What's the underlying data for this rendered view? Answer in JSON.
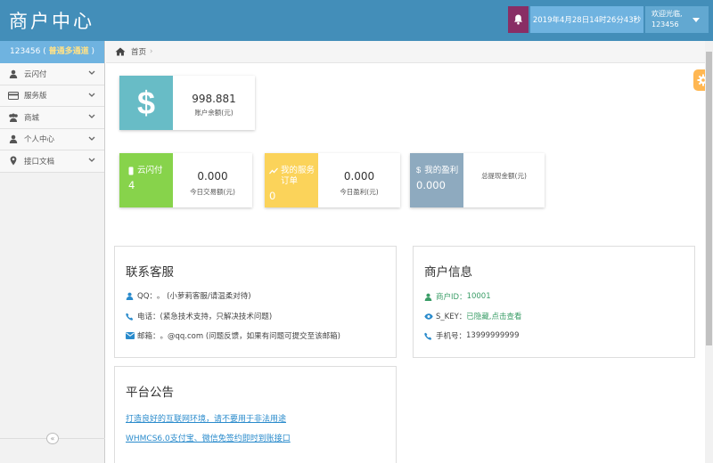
{
  "header": {
    "title": "商户中心",
    "datetime": "2019年4月28日14时26分43秒",
    "welcome": "欢迎光临,",
    "user": "123456"
  },
  "sidebar": {
    "account_id": "123456",
    "account_channel": "普通多通道",
    "items": [
      {
        "label": "云闪付",
        "icon": "user-icon"
      },
      {
        "label": "服务版",
        "icon": "credit-card-icon"
      },
      {
        "label": "商城",
        "icon": "users-icon"
      },
      {
        "label": "个人中心",
        "icon": "user-icon"
      },
      {
        "label": "接口文档",
        "icon": "map-marker-icon"
      }
    ],
    "collapse_glyph": "«"
  },
  "breadcrumb": {
    "home": "首页"
  },
  "stats": {
    "balance": {
      "value": "998.881",
      "label": "账户余额(元)",
      "symbol": "$"
    },
    "yunshanfu": {
      "title": "云闪付",
      "count": "4",
      "value": "0.000",
      "label": "今日交易额(元)"
    },
    "my_service": {
      "title": "我的服务订单",
      "count": "0",
      "value": "0.000",
      "label": "今日盈利(元)"
    },
    "my_profit": {
      "title": "我的盈利",
      "value": "0.000",
      "label": "总提现金额(元)"
    }
  },
  "contact": {
    "title": "联系客服",
    "qq_label": "QQ：",
    "qq_value": "。 (小萝莉客服/请温柔对待)",
    "phone_label": "电话：",
    "phone_value": "(紧急技术支持，只解决技术问题)",
    "email_label": "邮箱：",
    "email_value": "。@qq.com (问题反馈，如果有问题可提交至该邮箱)"
  },
  "merchant": {
    "title": "商户信息",
    "id_label": "商户ID：",
    "id_value": "10001",
    "skey_label": "S_KEY：",
    "skey_value": "已隐藏,点击查看",
    "phone_label": "手机号：",
    "phone_value": "13999999999"
  },
  "notice": {
    "title": "平台公告",
    "links": [
      "打造良好的互联网环境，请不要用于非法用途",
      "WHMCS6.0支付宝、微信免签约即时到账接口"
    ]
  },
  "colors": {
    "header": "#438eb9",
    "balance_tile": "#68bcc6",
    "yunshanfu_tile": "#87d34b",
    "service_tile": "#fbd35a",
    "profit_tile": "#8eaabf"
  }
}
